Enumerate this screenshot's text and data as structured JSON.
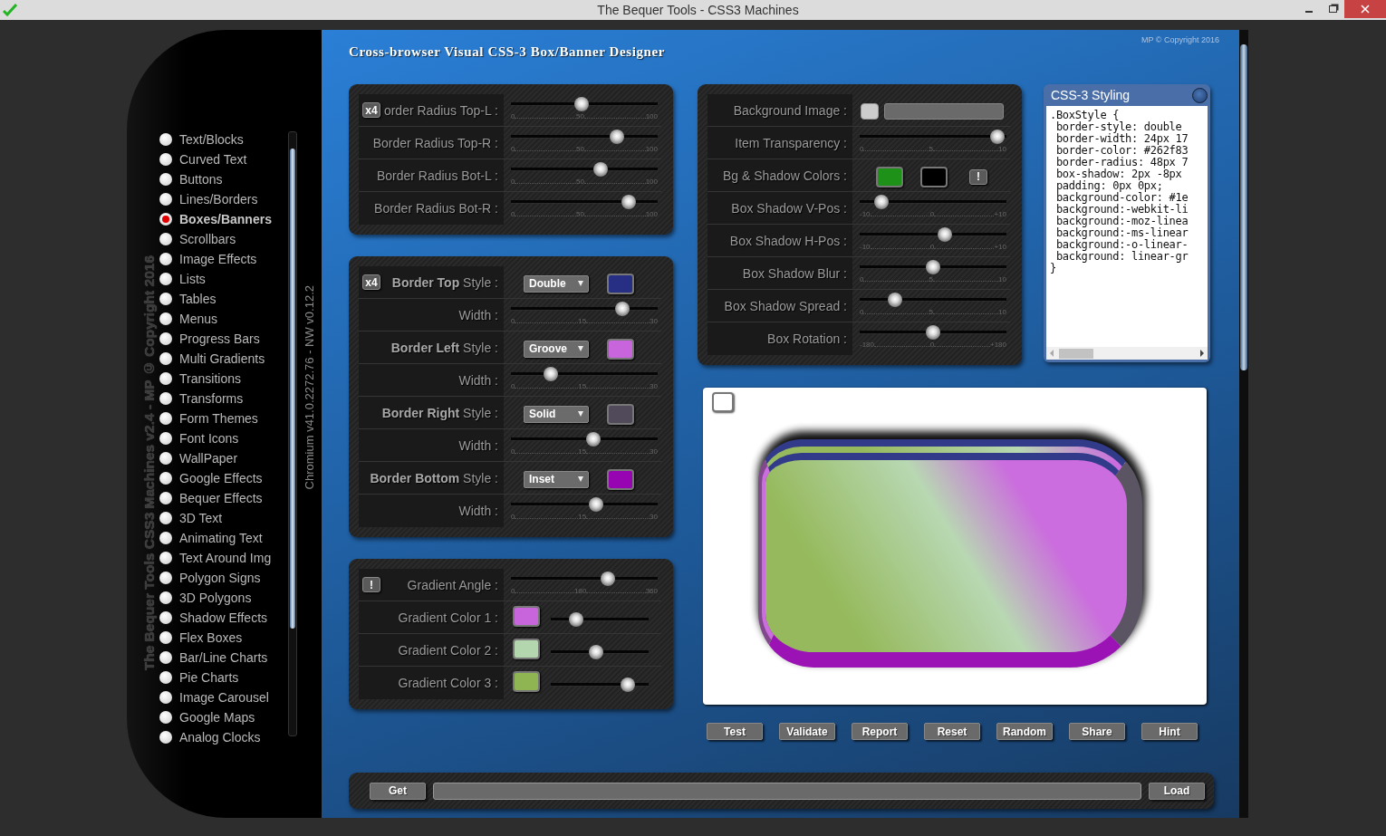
{
  "window": {
    "title": "The Bequer Tools - CSS3 Machines"
  },
  "sidebar": {
    "caption": "The Bequer Tools CSS3 Machines v2.4 - MP © Copyright 2016",
    "version": "Chromium v41.0.2272.76 - NW v0.12.2",
    "items": [
      {
        "label": "Text/Blocks",
        "selected": false
      },
      {
        "label": "Curved Text",
        "selected": false
      },
      {
        "label": "Buttons",
        "selected": false
      },
      {
        "label": "Lines/Borders",
        "selected": false
      },
      {
        "label": "Boxes/Banners",
        "selected": true
      },
      {
        "label": "Scrollbars",
        "selected": false
      },
      {
        "label": "Image Effects",
        "selected": false
      },
      {
        "label": "Lists",
        "selected": false
      },
      {
        "label": "Tables",
        "selected": false
      },
      {
        "label": "Menus",
        "selected": false
      },
      {
        "label": "Progress Bars",
        "selected": false
      },
      {
        "label": "Multi Gradients",
        "selected": false
      },
      {
        "label": "Transitions",
        "selected": false
      },
      {
        "label": "Transforms",
        "selected": false
      },
      {
        "label": "Form Themes",
        "selected": false
      },
      {
        "label": "Font Icons",
        "selected": false
      },
      {
        "label": "WallPaper",
        "selected": false
      },
      {
        "label": "Google Effects",
        "selected": false
      },
      {
        "label": "Bequer Effects",
        "selected": false
      },
      {
        "label": "3D Text",
        "selected": false
      },
      {
        "label": "Animating Text",
        "selected": false
      },
      {
        "label": "Text Around Img",
        "selected": false
      },
      {
        "label": "Polygon Signs",
        "selected": false
      },
      {
        "label": "3D Polygons",
        "selected": false
      },
      {
        "label": "Shadow Effects",
        "selected": false
      },
      {
        "label": "Flex Boxes",
        "selected": false
      },
      {
        "label": "Bar/Line Charts",
        "selected": false
      },
      {
        "label": "Pie Charts",
        "selected": false
      },
      {
        "label": "Image Carousel",
        "selected": false
      },
      {
        "label": "Google Maps",
        "selected": false
      },
      {
        "label": "Analog Clocks",
        "selected": false
      }
    ]
  },
  "header": {
    "title": "Cross-browser Visual CSS-3 Box/Banner Designer",
    "copyright": "MP © Copyright 2016"
  },
  "panels": [
    {
      "rows": [
        {
          "kind": "slider",
          "badge": "x4",
          "label": "order Radius Top-L :",
          "level": 0.48,
          "ticks": [
            "0",
            "50",
            "100"
          ]
        },
        {
          "kind": "slider",
          "label": "Border Radius Top-R :",
          "level": 0.72,
          "ticks": [
            "0",
            "50",
            "100"
          ]
        },
        {
          "kind": "slider",
          "label": "Border Radius Bot-L :",
          "level": 0.61,
          "ticks": [
            "0",
            "50",
            "100"
          ]
        },
        {
          "kind": "slider",
          "label": "Border Radius Bot-R :",
          "level": 0.8,
          "ticks": [
            "0",
            "50",
            "100"
          ]
        }
      ]
    },
    {
      "rows": [
        {
          "kind": "style",
          "badge": "x4",
          "label": "**Border Top** Style :",
          "value": "Double",
          "color": "#262f83"
        },
        {
          "kind": "slider",
          "label": "Width :",
          "level": 0.76,
          "ticks": [
            "0",
            "15",
            "30"
          ]
        },
        {
          "kind": "style",
          "label": "**Border Left** Style :",
          "value": "Groove",
          "color": "#c864dc"
        },
        {
          "kind": "slider",
          "label": "Width :",
          "level": 0.27,
          "ticks": [
            "0",
            "15",
            "30"
          ]
        },
        {
          "kind": "style",
          "label": "**Border Right** Style :",
          "value": "Solid",
          "color": "#514a5a"
        },
        {
          "kind": "slider",
          "label": "Width :",
          "level": 0.56,
          "ticks": [
            "0",
            "15",
            "30"
          ]
        },
        {
          "kind": "style",
          "label": "**Border Bottom** Style :",
          "value": "Inset",
          "color": "#9605b1"
        },
        {
          "kind": "slider",
          "label": "Width :",
          "level": 0.58,
          "ticks": [
            "0",
            "15",
            "30"
          ]
        }
      ]
    },
    {
      "rows": [
        {
          "kind": "slider",
          "badge": "!",
          "label": "Gradient Angle :",
          "level": 0.66,
          "ticks": [
            "0",
            "180",
            "360"
          ]
        },
        {
          "kind": "color_slider",
          "label": "Gradient Color 1 :",
          "color": "#c864dc",
          "level": 0.26
        },
        {
          "kind": "color_slider",
          "label": "Gradient Color 2 :",
          "color": "#b4d6ae",
          "level": 0.46
        },
        {
          "kind": "color_slider",
          "label": "Gradient Color 3 :",
          "color": "#8fb552",
          "level": 0.79
        }
      ]
    }
  ],
  "effects_panel": {
    "rows": [
      {
        "kind": "image",
        "label": "Background Image :"
      },
      {
        "kind": "slider",
        "label": "Item Transparency :",
        "level": 0.94,
        "ticks": [
          "0",
          "5",
          "10"
        ]
      },
      {
        "kind": "colors",
        "label": "Bg & Shadow Colors :",
        "colors": [
          {
            "color": "#1e9119"
          },
          {
            "color": "#000000"
          }
        ],
        "button": "!"
      },
      {
        "kind": "slider",
        "label": "Box Shadow V-Pos :",
        "level": 0.15,
        "ticks": [
          "-10",
          "0",
          "+10"
        ]
      },
      {
        "kind": "slider",
        "label": "Box Shadow H-Pos :",
        "level": 0.58,
        "ticks": [
          "-10",
          "0",
          "+10"
        ]
      },
      {
        "kind": "slider",
        "label": "Box Shadow Blur :",
        "level": 0.5,
        "ticks": [
          "0",
          "5",
          "10"
        ]
      },
      {
        "kind": "slider",
        "label": "Box Shadow Spread :",
        "level": 0.24,
        "ticks": [
          "0",
          "5",
          "10"
        ]
      },
      {
        "kind": "slider",
        "label": "Box Rotation :",
        "level": 0.5,
        "ticks": [
          "-180",
          "0",
          "+180"
        ]
      }
    ]
  },
  "css_panel": {
    "title": "CSS-3 Styling",
    "lines": [
      ".BoxStyle {",
      " border-style: double",
      " border-width: 24px 17",
      " border-color: #262f83",
      " border-radius: 48px 7",
      " box-shadow: 2px -8px",
      " padding: 0px 0px;",
      " background-color: #1e",
      " background:-webkit-li",
      " background:-moz-linea",
      " background:-ms-linear",
      " background:-o-linear-",
      " background: linear-gr",
      "}"
    ]
  },
  "preview": {
    "checked": false
  },
  "buttons": [
    "Test",
    "Validate",
    "Report",
    "Reset",
    "Random",
    "Share",
    "Hint"
  ],
  "bottom_bar": {
    "get": "Get",
    "load": "Load"
  }
}
